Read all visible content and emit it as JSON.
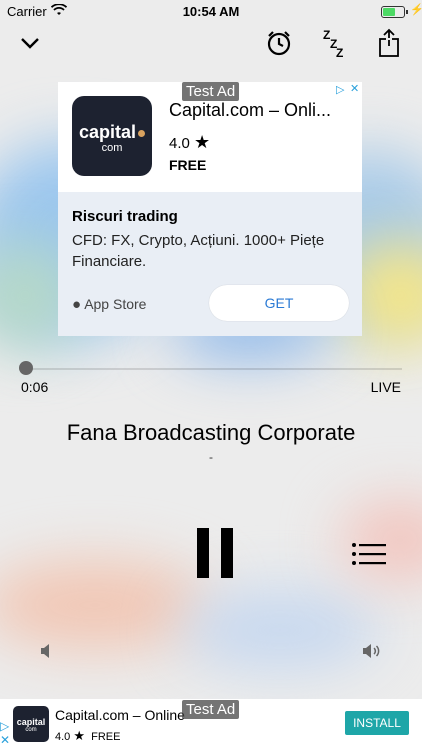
{
  "status_bar": {
    "carrier": "Carrier",
    "time": "10:54 AM"
  },
  "top_bar": {
    "icons": [
      "chevron-down-icon",
      "alarm-clock-icon",
      "sleep-timer-icon",
      "share-icon"
    ]
  },
  "native_ad": {
    "test_label": "Test Ad",
    "logo_text": "capital",
    "logo_sub": "com",
    "title": "Capital.com – Onli...",
    "rating": "4.0",
    "price": "FREE",
    "headline": "Riscuri trading",
    "body": "CFD: FX, Crypto, Acțiuni. 1000+ Piețe Financiare.",
    "store": "App Store",
    "cta": "GET"
  },
  "player": {
    "elapsed": "0:06",
    "live_label": "LIVE",
    "station_name": "Fana Broadcasting Corporate",
    "subtitle": "-",
    "progress": 0
  },
  "banner_ad": {
    "test_label": "Test Ad",
    "logo_text": "capital",
    "logo_sub": "com",
    "title": "Capital.com – Online",
    "rating": "4.0",
    "price": "FREE",
    "cta": "INSTALL"
  },
  "colors": {
    "install_button": "#1ea6a8",
    "get_text": "#2a7ad5",
    "adchoices": "#29a0db"
  }
}
